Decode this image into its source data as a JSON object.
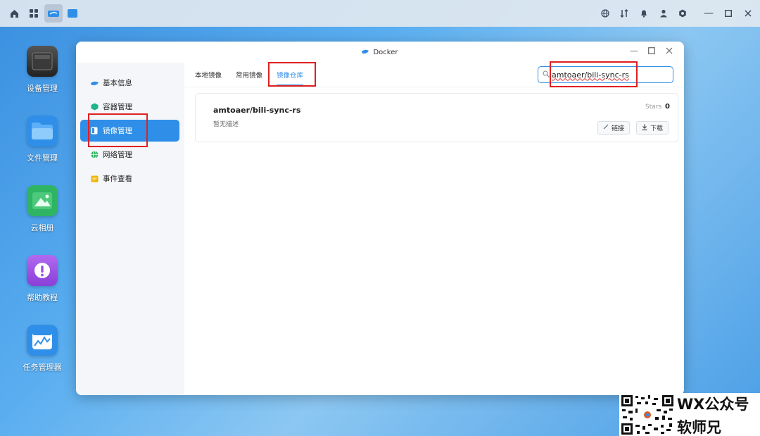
{
  "topbar": {
    "left_icons": [
      "home-icon",
      "apps-grid-icon",
      "docker-icon",
      "folder-icon"
    ],
    "right_icons": [
      "globe-icon",
      "transfer-icon",
      "bell-icon",
      "user-icon",
      "settings-icon",
      "minimize-icon",
      "maximize-icon",
      "close-icon"
    ]
  },
  "desktop": {
    "apps": [
      {
        "label": "设备管理",
        "icon": "device-icon"
      },
      {
        "label": "文件管理",
        "icon": "folder-icon"
      },
      {
        "label": "云相册",
        "icon": "photo-icon"
      },
      {
        "label": "帮助教程",
        "icon": "help-icon"
      },
      {
        "label": "任务管理器",
        "icon": "task-manager-icon"
      }
    ]
  },
  "window": {
    "title": "Docker",
    "sidebar": {
      "items": [
        {
          "label": "基本信息",
          "icon": "docker-icon"
        },
        {
          "label": "容器管理",
          "icon": "container-icon"
        },
        {
          "label": "镜像管理",
          "icon": "image-icon",
          "active": true
        },
        {
          "label": "网络管理",
          "icon": "network-icon"
        },
        {
          "label": "事件查看",
          "icon": "event-icon"
        }
      ]
    },
    "tabs": [
      {
        "label": "本地镜像"
      },
      {
        "label": "常用镜像"
      },
      {
        "label": "镜像仓库",
        "active": true
      }
    ],
    "search": {
      "value": "amtoaer/bili-sync-rs"
    },
    "results": [
      {
        "name": "amtoaer/bili-sync-rs",
        "description": "暂无描述",
        "stars_label": "Stars",
        "stars": "0",
        "link_label": "链接",
        "download_label": "下载"
      }
    ]
  },
  "watermark": {
    "line1": "WX公众号",
    "line2": "软师兄"
  },
  "colors": {
    "accent": "#2f8fe8",
    "highlight_box": "#e02020"
  }
}
